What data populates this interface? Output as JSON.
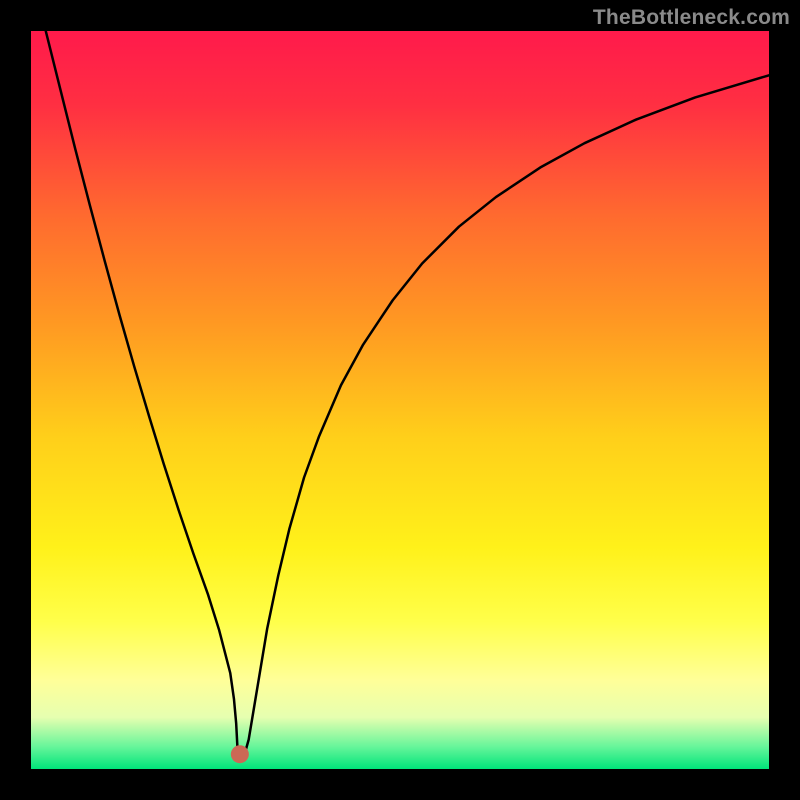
{
  "watermark": {
    "text": "TheBottleneck.com"
  },
  "chart_data": {
    "type": "line",
    "title": "",
    "xlabel": "",
    "ylabel": "",
    "xlim": [
      0,
      1000
    ],
    "ylim": [
      0,
      1000
    ],
    "grid": false,
    "legend": false,
    "background_gradient": {
      "stops": [
        {
          "offset": 0.0,
          "color": "#ff1a4b"
        },
        {
          "offset": 0.1,
          "color": "#ff2f42"
        },
        {
          "offset": 0.25,
          "color": "#ff6a2f"
        },
        {
          "offset": 0.4,
          "color": "#ff9a22"
        },
        {
          "offset": 0.55,
          "color": "#ffcf1a"
        },
        {
          "offset": 0.7,
          "color": "#fff11a"
        },
        {
          "offset": 0.8,
          "color": "#ffff4a"
        },
        {
          "offset": 0.88,
          "color": "#ffff99"
        },
        {
          "offset": 0.93,
          "color": "#e6ffb0"
        },
        {
          "offset": 0.97,
          "color": "#66f59a"
        },
        {
          "offset": 1.0,
          "color": "#00e47a"
        }
      ]
    },
    "series": [
      {
        "name": "bottleneck-curve",
        "color": "#000000",
        "stroke_width": 2.5,
        "x": [
          0,
          20,
          40,
          60,
          80,
          100,
          120,
          140,
          160,
          180,
          200,
          220,
          240,
          255,
          270,
          275,
          278,
          280,
          283,
          287,
          290,
          295,
          300,
          310,
          320,
          335,
          350,
          370,
          390,
          420,
          450,
          490,
          530,
          580,
          630,
          690,
          750,
          820,
          900,
          1000
        ],
        "values": [
          1080,
          1000,
          920,
          840,
          763,
          688,
          615,
          545,
          478,
          413,
          351,
          292,
          236,
          188,
          130,
          95,
          62,
          24,
          20,
          20,
          22,
          40,
          70,
          130,
          190,
          262,
          325,
          395,
          450,
          520,
          575,
          635,
          685,
          735,
          775,
          815,
          848,
          880,
          910,
          940
        ]
      }
    ],
    "marker": {
      "x": 283,
      "y": 20,
      "r": 9,
      "color": "#cc6955"
    }
  }
}
